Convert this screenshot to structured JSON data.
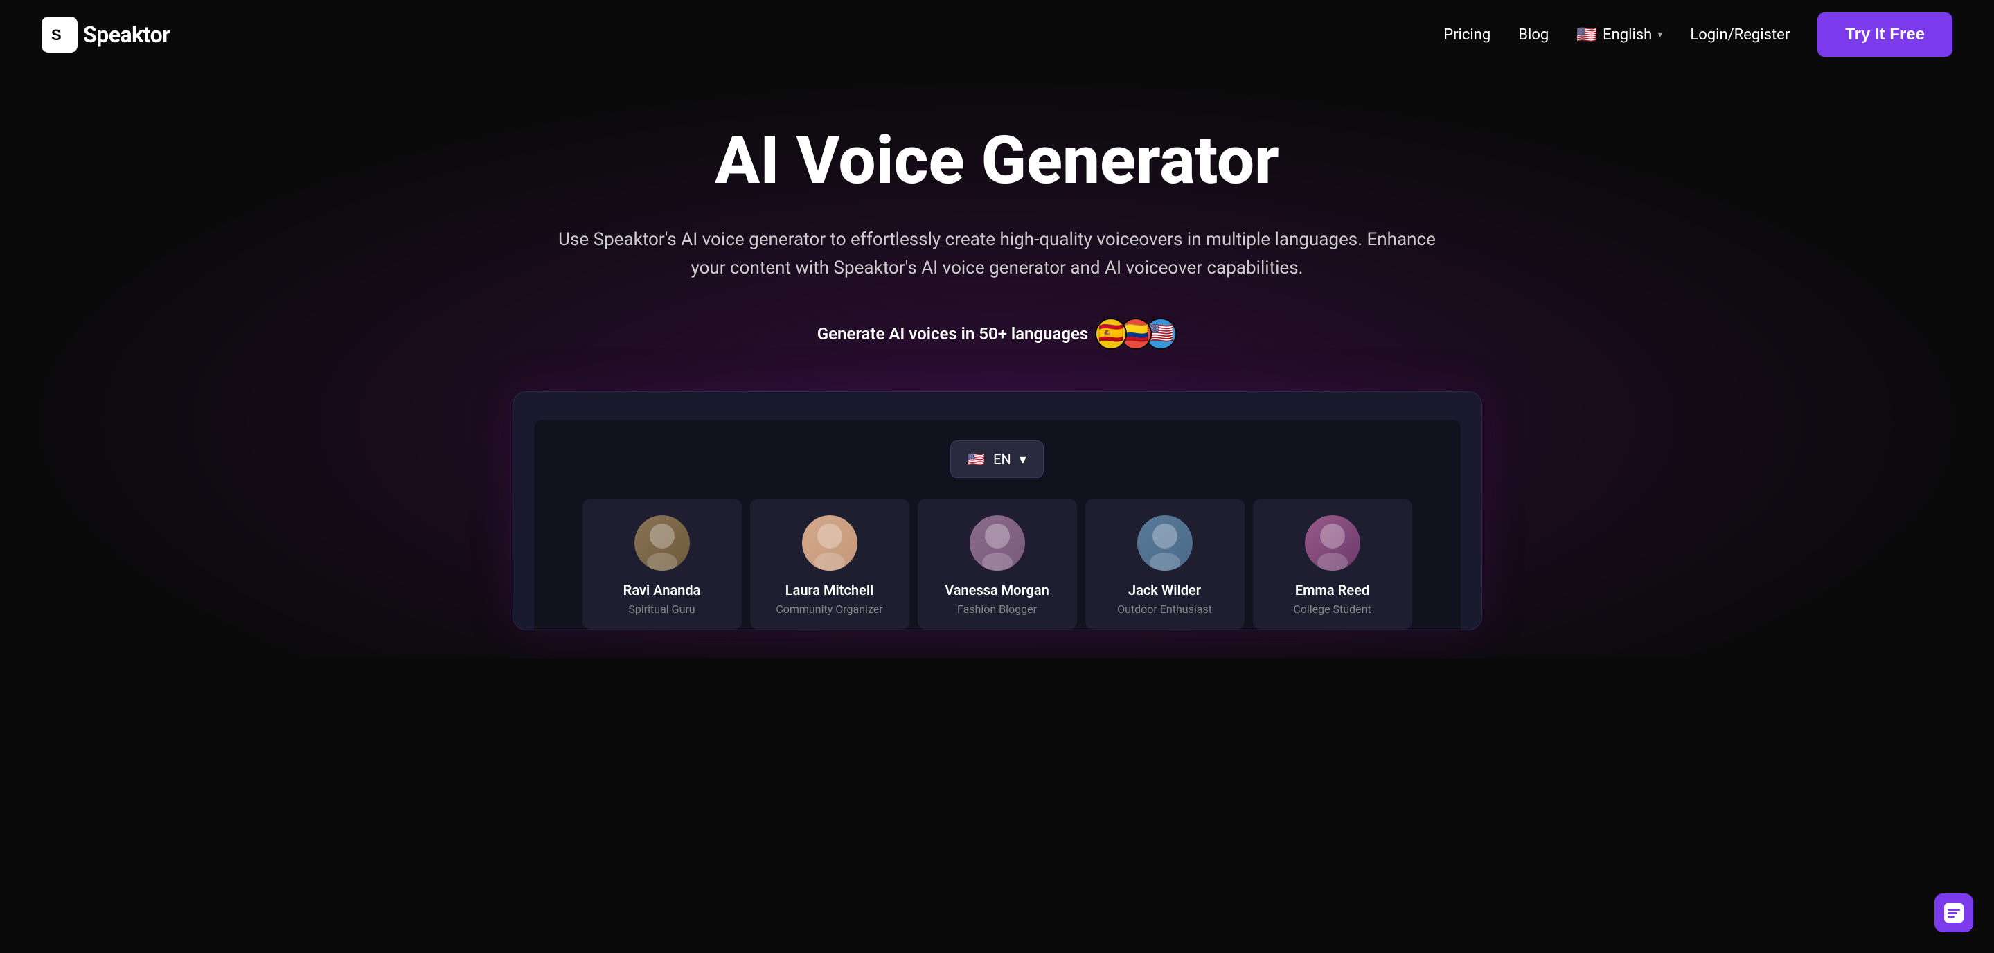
{
  "site": {
    "name": "Speaktor",
    "logo_text": "S"
  },
  "navbar": {
    "pricing_label": "Pricing",
    "blog_label": "Blog",
    "lang_flag": "🇺🇸",
    "lang_label": "English",
    "login_label": "Login/Register",
    "try_label": "Try It Free"
  },
  "hero": {
    "title": "AI Voice Generator",
    "description": "Use Speaktor's AI voice generator to effortlessly create high-quality voiceovers in multiple languages. Enhance your content with Speaktor's AI voice generator and AI voiceover capabilities.",
    "languages_label": "Generate AI voices in 50+ languages",
    "flags": [
      "🇪🇸",
      "🇨🇴",
      "🇺🇸"
    ]
  },
  "app_preview": {
    "lang_selector": {
      "flag": "🇺🇸",
      "label": "EN",
      "chevron": "▾"
    }
  },
  "voices": [
    {
      "id": "ravi",
      "name": "Ravi Ananda",
      "role": "Spiritual Guru",
      "emoji": "👨‍🦳",
      "avatar_class": "avatar-ravi"
    },
    {
      "id": "laura",
      "name": "Laura Mitchell",
      "role": "Community Organizer",
      "emoji": "👩",
      "avatar_class": "avatar-laura"
    },
    {
      "id": "vanessa",
      "name": "Vanessa Morgan",
      "role": "Fashion Blogger",
      "emoji": "👩‍🦱",
      "avatar_class": "avatar-vanessa"
    },
    {
      "id": "jack",
      "name": "Jack Wilder",
      "role": "Outdoor Enthusiast",
      "emoji": "👨",
      "avatar_class": "avatar-jack"
    },
    {
      "id": "emma",
      "name": "Emma Reed",
      "role": "College Student",
      "emoji": "👩‍🎤",
      "avatar_class": "avatar-emma"
    }
  ],
  "chat_widget": {
    "label": "Chat"
  }
}
